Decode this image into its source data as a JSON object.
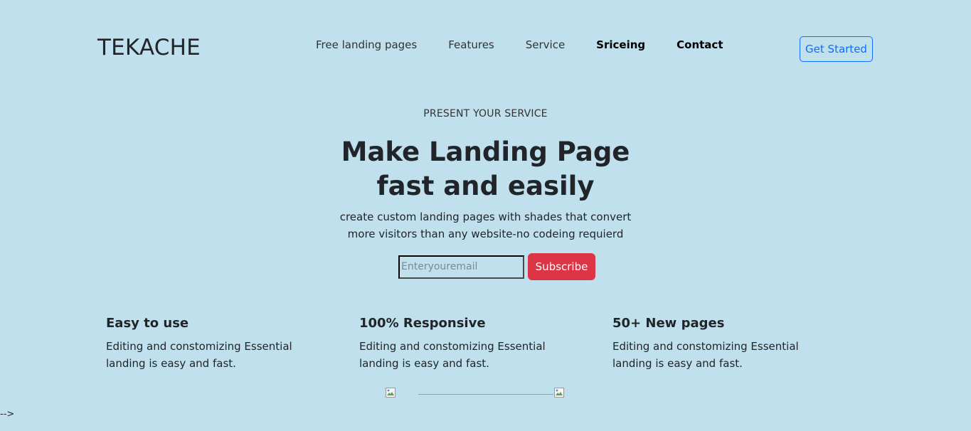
{
  "header": {
    "logo": "TEKACHE",
    "nav": [
      {
        "label": "Free landing pages"
      },
      {
        "label": "Features"
      },
      {
        "label": "Service"
      },
      {
        "label": "Sriceing"
      },
      {
        "label": "Contact"
      }
    ],
    "cta_label": "Get Started"
  },
  "hero": {
    "eyebrow": "PRESENT YOUR SERVICE",
    "headline_line1": "Make Landing Page",
    "headline_line2": "fast and easily",
    "lead_line1": "create custom landing pages with shades that convert",
    "lead_line2": "more visitors than any website-no codeing requierd",
    "email_placeholder": "Enteryouremail",
    "email_value": "",
    "subscribe_label": "Subscribe"
  },
  "features": [
    {
      "title": "Easy to use",
      "line1": "Editing and constomizing Essential",
      "line2": "landing is easy and fast."
    },
    {
      "title": "100% Responsive",
      "line1": "Editing and constomizing Essential",
      "line2": "landing is easy and fast."
    },
    {
      "title": "50+ New pages",
      "line1": "Editing and constomizing Essential",
      "line2": "landing is easy and fast."
    }
  ],
  "footer": {
    "left_image_icon": "broken-image-icon",
    "right_image_icon": "broken-image-icon",
    "stray_text": "-->"
  },
  "colors": {
    "background": "#bfe0ec",
    "accent_blue": "#0d6efd",
    "danger_red": "#dc3545",
    "text": "#212529"
  }
}
